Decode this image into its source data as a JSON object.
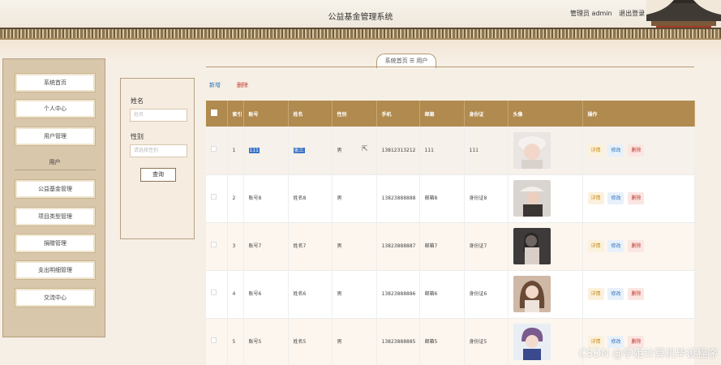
{
  "header": {
    "title": "公益基金管理系统",
    "role": "管理员 admin",
    "logout": "退出登录"
  },
  "breadcrumb": {
    "home": "系统首页",
    "sep": "☰",
    "current": "用户"
  },
  "sidebar": {
    "items": [
      {
        "label": "系统首页"
      },
      {
        "label": "个人中心"
      },
      {
        "label": "用户管理"
      }
    ],
    "group_label": "用户",
    "items2": [
      {
        "label": "公益基金管理"
      },
      {
        "label": "项目类型管理"
      },
      {
        "label": "捐赠管理"
      },
      {
        "label": "支出明细管理"
      },
      {
        "label": "交流中心"
      }
    ]
  },
  "search": {
    "name_label": "姓名",
    "name_placeholder": "姓名",
    "gender_label": "性别",
    "gender_placeholder": "请选择性别",
    "query_button": "查询"
  },
  "toolbar": {
    "add": "新增",
    "delete": "删除"
  },
  "table": {
    "headers": [
      "",
      "索引",
      "账号",
      "姓名",
      "性别",
      "手机",
      "邮箱",
      "身份证",
      "头像",
      "操作"
    ],
    "rows": [
      {
        "idx": "1",
        "account": "111",
        "name": "张三",
        "gender": "男",
        "phone": "13812313212",
        "email": "111",
        "id": "111"
      },
      {
        "idx": "2",
        "account": "账号8",
        "name": "姓名8",
        "gender": "男",
        "phone": "13823888888",
        "email": "邮箱8",
        "id": "身份证8"
      },
      {
        "idx": "3",
        "account": "账号7",
        "name": "姓名7",
        "gender": "男",
        "phone": "13823888887",
        "email": "邮箱7",
        "id": "身份证7"
      },
      {
        "idx": "4",
        "account": "账号6",
        "name": "姓名6",
        "gender": "男",
        "phone": "13823888886",
        "email": "邮箱6",
        "id": "身份证6"
      },
      {
        "idx": "5",
        "account": "账号5",
        "name": "姓名5",
        "gender": "男",
        "phone": "13823888885",
        "email": "邮箱5",
        "id": "身份证5"
      }
    ],
    "ops": {
      "detail": "详情",
      "edit": "修改",
      "delete": "删除"
    }
  },
  "watermark": "CSDN @学姐计算机毕设程序",
  "colors": {
    "accent": "#b08a4e",
    "edit": "#2f74b8",
    "delete": "#c0392b",
    "detail": "#c88a1a"
  }
}
